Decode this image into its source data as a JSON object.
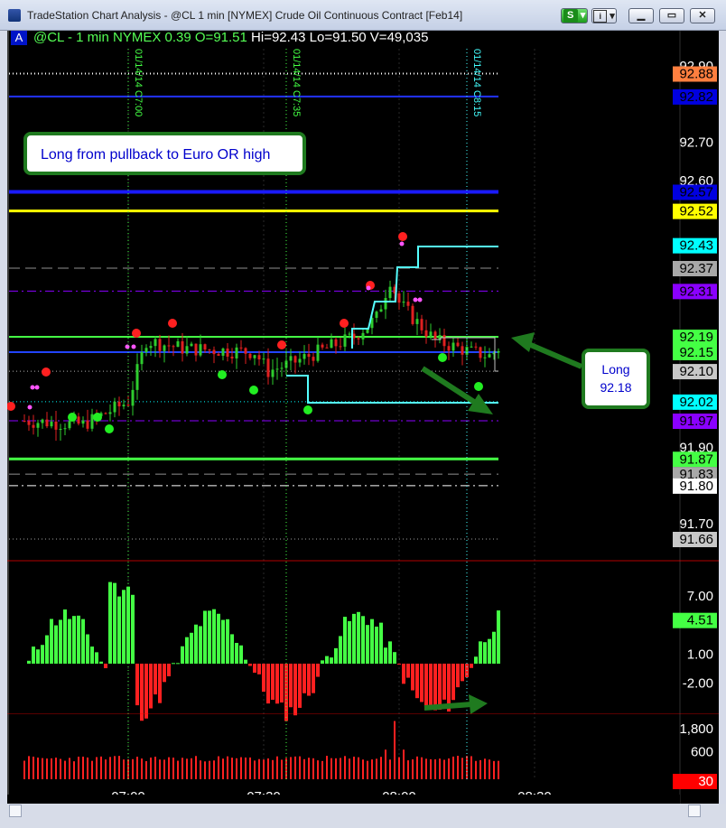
{
  "window": {
    "title": "TradeStation Chart Analysis - @CL 1 min [NYMEX] Crude Oil Continuous Contract [Feb14]",
    "strategy_button_label": "S",
    "info_button_label": "i"
  },
  "chart_header": {
    "badge": "A",
    "symbol_text": "@CL - 1 min  NYMEX  0.39  O=91.51",
    "ohlc_text": " Hi=92.43  Lo=91.50  V=49,035"
  },
  "chart_data": {
    "type": "bar",
    "title": "@CL - 1 min  NYMEX  0.39  O=91.51 Hi=92.43 Lo=91.50 V=49,035",
    "x_ticks": [
      "07:00",
      "07:30",
      "08:00",
      "08:30"
    ],
    "price_panel": {
      "ylim": [
        91.63,
        92.93
      ],
      "y_ticks": [
        "92.90",
        "92.70",
        "92.60",
        "91.90",
        "91.70"
      ],
      "y_tick_values": [
        92.9,
        92.7,
        92.6,
        91.9,
        91.7
      ],
      "session_markers": [
        {
          "label": "01/14/14 C7:00",
          "x_time": "07:00",
          "color": "#44ff44"
        },
        {
          "label": "01/14/14 C7:35",
          "x_time": "07:35",
          "color": "#44ff44"
        },
        {
          "label": "01/14/14 C8:15",
          "x_time": "08:15",
          "color": "#44ffff"
        }
      ],
      "level_labels": [
        {
          "text": "92.88",
          "value": 92.88,
          "bg": "#ff7f3f",
          "fg": "#000000"
        },
        {
          "text": "92.82",
          "value": 92.82,
          "bg": "#0000e0",
          "fg": "#000000"
        },
        {
          "text": "92.57",
          "value": 92.57,
          "bg": "#0000e0",
          "fg": "#000000"
        },
        {
          "text": "92.52",
          "value": 92.52,
          "bg": "#ffff00",
          "fg": "#000000"
        },
        {
          "text": "92.43",
          "value": 92.43,
          "bg": "#00ffff",
          "fg": "#000000"
        },
        {
          "text": "92.37",
          "value": 92.37,
          "bg": "#a8a8a8",
          "fg": "#000000"
        },
        {
          "text": "92.31",
          "value": 92.31,
          "bg": "#8a00ff",
          "fg": "#000000"
        },
        {
          "text": "92.19",
          "value": 92.19,
          "bg": "#44ff44",
          "fg": "#000000"
        },
        {
          "text": "92.15",
          "value": 92.15,
          "bg": "#44ff44",
          "fg": "#000000"
        },
        {
          "text": "92.10",
          "value": 92.1,
          "bg": "#c8c8c8",
          "fg": "#000000"
        },
        {
          "text": "92.02",
          "value": 92.02,
          "bg": "#00ffff",
          "fg": "#000000"
        },
        {
          "text": "91.97",
          "value": 91.97,
          "bg": "#8a00ff",
          "fg": "#000000"
        },
        {
          "text": "91.87",
          "value": 91.87,
          "bg": "#44ff44",
          "fg": "#000000"
        },
        {
          "text": "91.83",
          "value": 91.83,
          "bg": "#a8a8a8",
          "fg": "#000000"
        },
        {
          "text": "91.80",
          "value": 91.8,
          "bg": "#ffffff",
          "fg": "#000000"
        },
        {
          "text": "91.66",
          "value": 91.66,
          "bg": "#c8c8c8",
          "fg": "#000000"
        }
      ],
      "annotations": [
        {
          "text": "Long from pullback to Euro OR high"
        },
        {
          "text": "Long\n92.18"
        }
      ]
    },
    "oscillator_panel": {
      "y_ticks": [
        "7.00",
        "1.00",
        "-2.00"
      ],
      "y_tick_values": [
        7.0,
        1.0,
        -2.0
      ],
      "last_value_label": {
        "text": "4.51",
        "value": 4.51,
        "bg": "#44ff44"
      }
    },
    "volume_panel": {
      "y_ticks": [
        "1,800",
        "600"
      ],
      "y_tick_values": [
        1800,
        600
      ],
      "last_value_label": {
        "text": "30",
        "value": 30,
        "bg": "#ff0000"
      }
    }
  },
  "colors": {
    "up_bar": "#2ecc2e",
    "down_bar": "#e02020",
    "background": "#000000",
    "annotation_border": "#1f7a1f",
    "annotation_text": "#0000cc"
  }
}
